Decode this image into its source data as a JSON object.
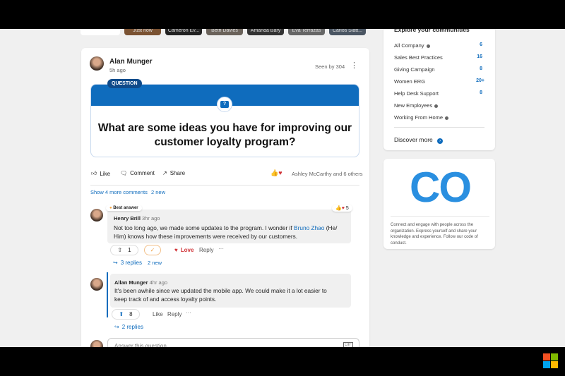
{
  "stories": [
    "Just now",
    "Cameron Ev...",
    "Beth Davies",
    "Amanda Bary",
    "Eva Terrazas",
    "Carlos Slatt..."
  ],
  "post": {
    "author": "Alan Munger",
    "time": "5h ago",
    "seen": "Seen by 304",
    "badge": "QUESTION",
    "question": "What are some ideas you have for improving our customer loyalty program?",
    "like": "Like",
    "comment": "Comment",
    "share": "Share",
    "reactors": "Ashley McCarthy and 6 others",
    "show_more": "Show 4 more comments",
    "show_more_new": "2 new"
  },
  "comments": [
    {
      "badge": "Best answer",
      "author": "Henry Brill",
      "time": "3hr ago",
      "text_before": "Not too long ago, we made some updates to the program. I wonder if ",
      "mention": "Bruno Zhao",
      "text_after": " (He/ Him) knows how these improvements were received by our customers.",
      "reaction_count": "5",
      "upvotes": "1",
      "love": "Love",
      "reply": "Reply",
      "replies": "3 replies",
      "replies_new": "2 new"
    },
    {
      "author": "Allan Munger",
      "time": "4hr ago",
      "text": "It's been awhile since we updated the mobile app. We could make it a lot easier to keep track of and access loyalty points.",
      "upvotes": "8",
      "like": "Like",
      "reply": "Reply",
      "replies": "2 replies"
    }
  ],
  "answer_placeholder": "Answer this question",
  "sidebar": {
    "title": "Explore your communities",
    "communities": [
      {
        "name": "All Company",
        "count": "6"
      },
      {
        "name": "Sales Best Practices",
        "count": "16"
      },
      {
        "name": "Giving Campaign",
        "count": "8"
      },
      {
        "name": "Women ERG",
        "count": "20+"
      },
      {
        "name": "Help Desk Support",
        "count": "8"
      },
      {
        "name": "New Employees",
        "count": ""
      },
      {
        "name": "Working From Home",
        "count": ""
      }
    ],
    "discover": "Discover more",
    "logo": "CO",
    "description": "Connect and engage with people across the organization. Express yourself and share your knowledge and experience. Follow our code of conduct."
  },
  "colors": {
    "accent": "#0f6cbd",
    "love": "#d13438"
  }
}
